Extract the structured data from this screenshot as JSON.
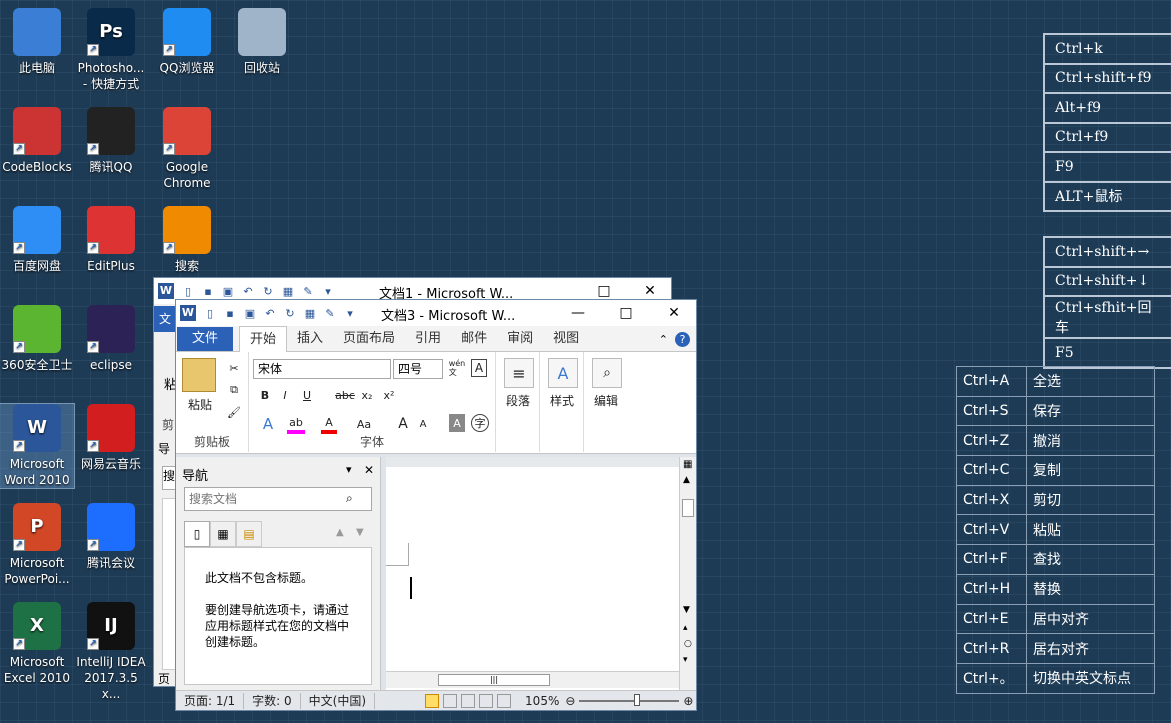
{
  "desktop": {
    "icons": [
      {
        "label": "此电脑",
        "color": "#3a7fd5"
      },
      {
        "label": "Photosho...\n- 快捷方式",
        "color": "#0a2a4a",
        "text": "Ps"
      },
      {
        "label": "QQ浏览器",
        "color": "#1e8cf0"
      },
      {
        "label": "回收站",
        "color": "#9fb4c8"
      },
      {
        "label": "CodeBlocks",
        "color": "#c33"
      },
      {
        "label": "腾讯QQ",
        "color": "#222"
      },
      {
        "label": "Google\nChrome",
        "color": "#db4437"
      },
      {
        "label": "百度网盘",
        "color": "#2f8ef5"
      },
      {
        "label": "EditPlus",
        "color": "#d33"
      },
      {
        "label": "搜索",
        "color": "#f08a00"
      },
      {
        "label": "360安全卫士",
        "color": "#5cb531"
      },
      {
        "label": "eclipse",
        "color": "#2c2255"
      },
      {
        "label": "Microsoft\nWord 2010",
        "color": "#2b579a",
        "text": "W"
      },
      {
        "label": "网易云音乐",
        "color": "#d21e1e"
      },
      {
        "label": "Microsoft\nPowerPoi...",
        "color": "#d24726",
        "text": "P"
      },
      {
        "label": "腾讯会议",
        "color": "#1d6dff"
      },
      {
        "label": "Microsoft\nExcel 2010",
        "color": "#1e7145",
        "text": "X"
      },
      {
        "label": "IntelliJ IDEA\n2017.3.5 x...",
        "color": "#111",
        "text": "IJ"
      }
    ]
  },
  "table1": [
    "Ctrl+k",
    "Ctrl+shift+f9",
    "Alt+f9",
    "Ctrl+f9",
    "F9",
    "ALT+鼠标"
  ],
  "table2": [
    "Ctrl+shift+→",
    "Ctrl+shift+↓",
    "Ctrl+sfhit+回车",
    "F5"
  ],
  "shortcuts": [
    [
      "Ctrl+A",
      "全选"
    ],
    [
      "Ctrl+S",
      "保存"
    ],
    [
      "Ctrl+Z",
      "撤消"
    ],
    [
      "Ctrl+C",
      "复制"
    ],
    [
      "Ctrl+X",
      "剪切"
    ],
    [
      "Ctrl+V",
      "粘贴"
    ],
    [
      "Ctrl+F",
      "查找"
    ],
    [
      "Ctrl+H",
      "替换"
    ],
    [
      "Ctrl+E",
      "居中对齐"
    ],
    [
      "Ctrl+R",
      "居右对齐"
    ],
    [
      "Ctrl+。",
      "切换中英文标点"
    ]
  ],
  "win1": {
    "title": "文档1 - Microsoft W...",
    "tab_file": "文",
    "side1": "粘",
    "side2": "剪",
    "side3": "导",
    "side4": "搜",
    "side5": "页"
  },
  "win3": {
    "title": "文档3 - Microsoft W...",
    "tabs": [
      "文件",
      "开始",
      "插入",
      "页面布局",
      "引用",
      "邮件",
      "审阅",
      "视图"
    ],
    "ribbon": {
      "paste": "粘贴",
      "clipboard": "剪贴板",
      "font_name": "宋体",
      "font_size": "四号",
      "font": "字体",
      "paragraph": "段落",
      "styles": "样式",
      "editing": "编辑",
      "wen": "wén\n文",
      "bold": "B",
      "italic": "I",
      "underline": "U",
      "strike": "abc",
      "sub": "x₂",
      "sup": "x²",
      "grow": "A",
      "shrink": "A",
      "case": "Aa",
      "A_box": "A",
      "char_border": "A",
      "phon": "字"
    },
    "nav": {
      "title": "导航",
      "search_placeholder": "搜索文档",
      "msg1": "此文档不包含标题。",
      "msg2": "要创建导航选项卡，请通过应用标题样式在您的文档中创建标题。"
    },
    "status": {
      "page": "页面: 1/1",
      "words": "字数: 0",
      "lang": "中文(中国)",
      "zoom": "105%"
    }
  }
}
